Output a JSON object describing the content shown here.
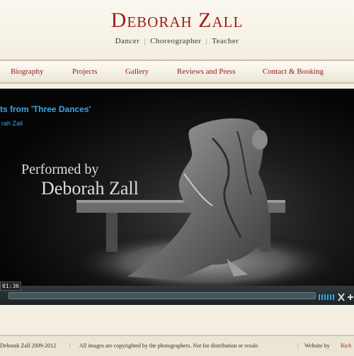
{
  "site": {
    "title": "Deborah Zall",
    "tagline": [
      "Dancer",
      "Choreographer",
      "Teacher"
    ]
  },
  "nav": {
    "items": [
      {
        "label": "Biography"
      },
      {
        "label": "Projects"
      },
      {
        "label": "Gallery"
      },
      {
        "label": "Reviews and Press"
      },
      {
        "label": "Contact & Booking"
      }
    ]
  },
  "video": {
    "title": "ts from 'Three Dances'",
    "byline": "rah Zall",
    "overlay_line1": "Performed by",
    "overlay_line2": "Deborah Zall",
    "timecode": "01:36",
    "progress": 0.0
  },
  "footer": {
    "copyright": "Deborah Zall 2009-2012",
    "notice": "All images are copyrighted by the photographers. Not for distribution or resale.",
    "credit_prefix": "Website by",
    "credit_name": "Rich"
  },
  "colors": {
    "brand": "#9b1d1d",
    "video_title": "#37a7e6",
    "page_bg": "#f4efe2"
  }
}
